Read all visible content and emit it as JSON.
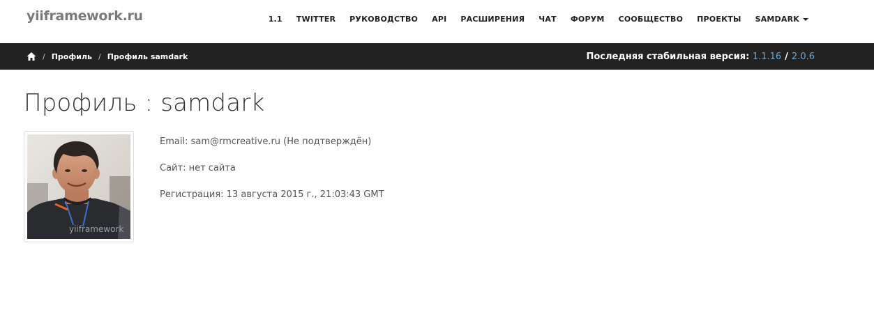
{
  "logo": {
    "part1": "yii",
    "part2": "framework.ru"
  },
  "nav": {
    "items": [
      "1.1",
      "TWITTER",
      "РУКОВОДСТВО",
      "API",
      "РАСШИРЕНИЯ",
      "ЧАТ",
      "ФОРУМ",
      "СООБЩЕСТВО",
      "ПРОЕКТЫ"
    ],
    "user": "SAMDARK"
  },
  "breadcrumb": {
    "items": [
      "Профиль",
      "Профиль samdark"
    ],
    "separator": "/"
  },
  "version": {
    "label": "Последняя стабильная версия:",
    "v1": "1.1.16",
    "separator": "/",
    "v2": "2.0.6"
  },
  "page": {
    "title": "Профиль : samdark"
  },
  "profile": {
    "email": "Email: sam@rmcreative.ru (Не подтверждён)",
    "site": "Сайт: нет сайта",
    "registration": "Регистрация: 13 августа 2015 г., 21:03:43 GMT",
    "avatar_shirt_text": "yiiframework"
  },
  "colors": {
    "breadcrumb_bg": "#222222",
    "link": "#6aa6d6",
    "text": "#555555"
  }
}
